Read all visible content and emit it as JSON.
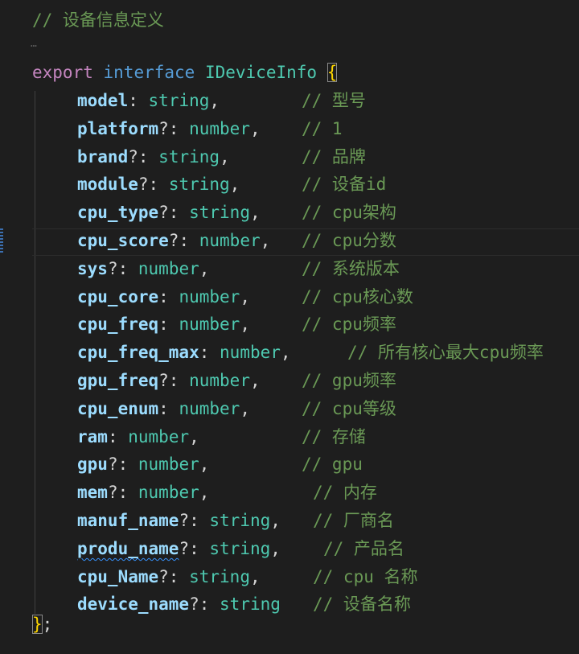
{
  "header_comment": "// 设备信息定义",
  "folded_marker": "…",
  "declaration": {
    "export_kw": "export",
    "interface_kw": "interface",
    "name": "IDeviceInfo",
    "open_brace": "{",
    "close_brace": "}",
    "terminator": ";"
  },
  "fields": [
    {
      "name": "model",
      "sep": ":",
      "type": "string",
      "trail": ",",
      "comment": "// 型号"
    },
    {
      "name": "platform",
      "sep": "?:",
      "type": "number",
      "trail": ",",
      "comment": "// 1"
    },
    {
      "name": "brand",
      "sep": "?:",
      "type": "string",
      "trail": ",",
      "comment": "// 品牌"
    },
    {
      "name": "module",
      "sep": "?:",
      "type": "string",
      "trail": ",",
      "comment": "// 设备id"
    },
    {
      "name": "cpu_type",
      "sep": "?:",
      "type": "string",
      "trail": ",",
      "comment": "// cpu架构"
    },
    {
      "name": "cpu_score",
      "sep": "?:",
      "type": "number",
      "trail": ",",
      "comment": "// cpu分数"
    },
    {
      "name": "sys",
      "sep": "?:",
      "type": "number",
      "trail": ",",
      "comment": "// 系统版本"
    },
    {
      "name": "cpu_core",
      "sep": ":",
      "type": "number",
      "trail": ",",
      "comment": "// cpu核心数"
    },
    {
      "name": "cpu_freq",
      "sep": ":",
      "type": "number",
      "trail": ",",
      "comment": "// cpu频率"
    },
    {
      "name": "cpu_freq_max",
      "sep": ":",
      "type": "number",
      "trail": ",",
      "comment": "// 所有核心最大cpu频率"
    },
    {
      "name": "gpu_freq",
      "sep": "?:",
      "type": "number",
      "trail": ",",
      "comment": "// gpu频率"
    },
    {
      "name": "cpu_enum",
      "sep": ":",
      "type": "number",
      "trail": ",",
      "comment": "// cpu等级"
    },
    {
      "name": "ram",
      "sep": ":",
      "type": "number",
      "trail": ",",
      "comment": "// 存储"
    },
    {
      "name": "gpu",
      "sep": "?:",
      "type": "number",
      "trail": ",",
      "comment": "// gpu"
    },
    {
      "name": "mem",
      "sep": "?:",
      "type": "number",
      "trail": ",",
      "comment": "// 内存"
    },
    {
      "name": "manuf_name",
      "sep": "?:",
      "type": "string",
      "trail": ",",
      "comment": "// 厂商名"
    },
    {
      "name": "produ_name",
      "sep": "?:",
      "type": "string",
      "trail": ",",
      "comment": "// 产品名"
    },
    {
      "name": "cpu_Name",
      "sep": "?:",
      "type": "string",
      "trail": ",",
      "comment": "// cpu 名称"
    },
    {
      "name": "device_name",
      "sep": "?:",
      "type": "string",
      "trail": "",
      "comment": "// 设备名称"
    }
  ],
  "colors": {
    "background": "#1e1e1e",
    "comment": "#6a9955",
    "property": "#9cdcfe",
    "type": "#4ec9b0",
    "keyword": "#569cd6",
    "export_keyword": "#c586c0",
    "brace": "#ffd700"
  }
}
